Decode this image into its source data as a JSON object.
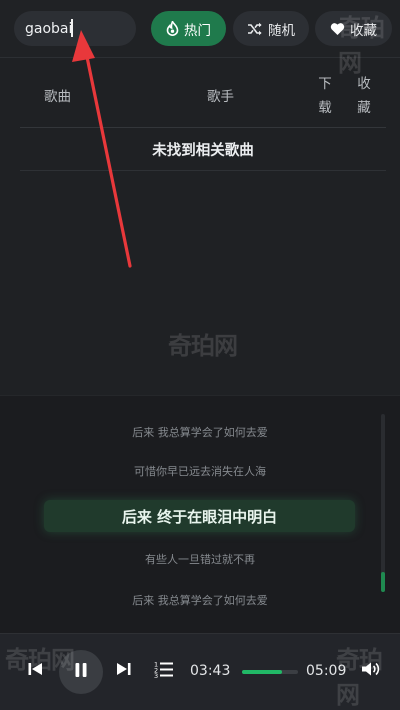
{
  "search": {
    "value": "gaobai",
    "placeholder": ""
  },
  "toolbar": {
    "hot_label": "热门",
    "random_label": "随机",
    "favorite_label": "收藏"
  },
  "table": {
    "headers": {
      "song": "歌曲",
      "singer": "歌手",
      "download": "下载",
      "collect": "收藏"
    },
    "empty_message": "未找到相关歌曲"
  },
  "lyrics": {
    "lines": [
      "后来 我总算学会了如何去爱",
      "可惜你早已远去消失在人海",
      "后来 终于在眼泪中明白",
      "有些人一旦错过就不再",
      "后来 我总算学会了如何去爱"
    ],
    "current_index": 2
  },
  "player": {
    "current_time": "03:43",
    "total_time": "05:09",
    "progress_fraction": 0.72
  },
  "watermark": "奇珀网",
  "colors": {
    "accent": "#1f7a4c",
    "progress": "#21b866",
    "annotation_arrow": "#e8383b"
  }
}
